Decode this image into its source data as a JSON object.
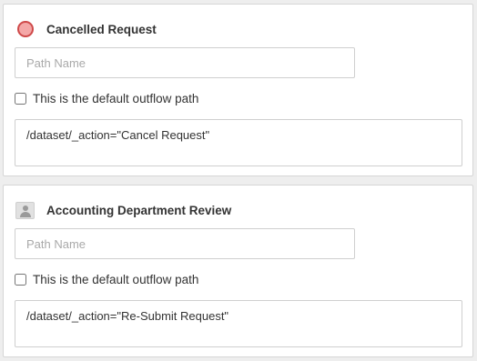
{
  "paths": [
    {
      "title": "Cancelled Request",
      "icon": "stop-circle-icon",
      "path_name_placeholder": "Path Name",
      "path_name_value": "",
      "default_checkbox_label": "This is the default outflow path",
      "default_checked": false,
      "expression": "/dataset/_action=\"Cancel Request\""
    },
    {
      "title": "Accounting Department Review",
      "icon": "user-icon",
      "path_name_placeholder": "Path Name",
      "path_name_value": "",
      "default_checkbox_label": "This is the default outflow path",
      "default_checked": false,
      "expression": "/dataset/_action=\"Re-Submit Request\""
    }
  ],
  "colors": {
    "stop_fill": "#f4a7a7",
    "stop_border": "#cf4a4a",
    "border": "#cfcfcf",
    "background": "#eeeeee"
  }
}
